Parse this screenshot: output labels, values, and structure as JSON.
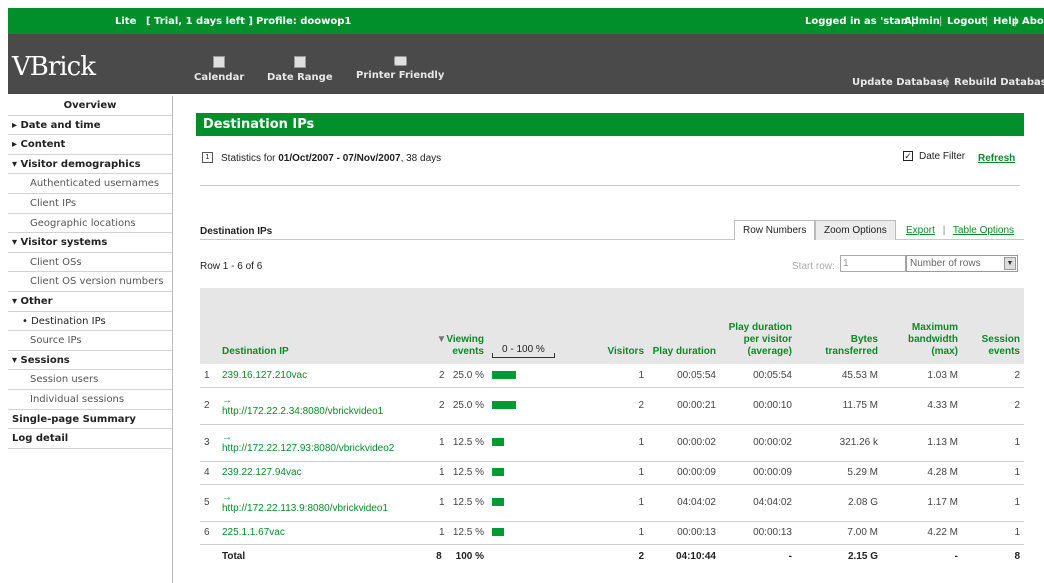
{
  "topbar": {
    "edition": "Lite",
    "trial": "[ Trial, 1 days left ]",
    "profile": "Profile: doowop1",
    "logged_in": "Logged in as 'stan'|",
    "admin": "Admin",
    "logout": "Logout",
    "help": "Help",
    "about": "Abou"
  },
  "header": {
    "logo": "VBrick",
    "tools": [
      "Calendar",
      "Date Range",
      "Printer Friendly"
    ],
    "update_db": "Update Database",
    "rebuild_db": "Rebuild Databas"
  },
  "sidebar": {
    "items": [
      {
        "label": "Overview",
        "type": "top-center"
      },
      {
        "label": "▸ Date and time",
        "type": "top"
      },
      {
        "label": "▸ Content",
        "type": "top"
      },
      {
        "label": "▾ Visitor demographics",
        "type": "top"
      },
      {
        "label": "Authenticated usernames",
        "type": "sub"
      },
      {
        "label": "Client IPs",
        "type": "sub"
      },
      {
        "label": "Geographic locations",
        "type": "sub"
      },
      {
        "label": "▾ Visitor systems",
        "type": "top"
      },
      {
        "label": "Client OSs",
        "type": "sub"
      },
      {
        "label": "Client OS version numbers",
        "type": "sub"
      },
      {
        "label": "▾ Other",
        "type": "top"
      },
      {
        "label": "• Destination IPs",
        "type": "current"
      },
      {
        "label": "Source IPs",
        "type": "sub"
      },
      {
        "label": "▾ Sessions",
        "type": "top"
      },
      {
        "label": "Session users",
        "type": "sub"
      },
      {
        "label": "Individual sessions",
        "type": "sub"
      },
      {
        "label": "Single-page Summary",
        "type": "top"
      },
      {
        "label": "Log detail",
        "type": "top"
      }
    ]
  },
  "page": {
    "title": "Destination IPs",
    "stats_prefix": "Statistics for",
    "stats_range": "01/Oct/2007 - 07/Nov/2007",
    "stats_suffix": ", 38 days",
    "date_filter": "Date Filter",
    "date_filter_checked": true,
    "refresh": "Refresh",
    "section_title": "Destination IPs",
    "tab_row_numbers": "Row Numbers",
    "tab_zoom": "Zoom Options",
    "export": "Export",
    "table_options": "Table Options",
    "row_info": "Row 1 - 6 of 6",
    "start_row_label": "Start row:",
    "start_row_value": "1",
    "number_of_rows": "Number of rows"
  },
  "table": {
    "headers": {
      "dest_ip": "Destination IP",
      "viewing_events": "Viewing events",
      "scale": "0 - 100 %",
      "visitors": "Visitors",
      "play_duration": "Play duration",
      "play_per_visitor": "Play duration per visitor (average)",
      "bytes": "Bytes transferred",
      "max_bw": "Maximum bandwidth (max)",
      "session_events": "Session events"
    },
    "rows": [
      {
        "n": "1",
        "ip": "239.16.127.210vac",
        "ip_is_url": false,
        "events": "2",
        "pct": "25.0 %",
        "pct_value": 25,
        "visitors": "1",
        "play": "00:05:54",
        "per_visitor": "00:05:54",
        "bytes": "45.53 M",
        "bw": "1.03 M",
        "sessions": "2"
      },
      {
        "n": "2",
        "ip": "http://172.22.2.34:8080/vbrickvideo1",
        "ip_is_url": true,
        "events": "2",
        "pct": "25.0 %",
        "pct_value": 25,
        "visitors": "2",
        "play": "00:00:21",
        "per_visitor": "00:00:10",
        "bytes": "11.75 M",
        "bw": "4.33 M",
        "sessions": "2"
      },
      {
        "n": "3",
        "ip": "http://172.22.127.93:8080/vbrickvideo2",
        "ip_is_url": true,
        "events": "1",
        "pct": "12.5 %",
        "pct_value": 12.5,
        "visitors": "1",
        "play": "00:00:02",
        "per_visitor": "00:00:02",
        "bytes": "321.26 k",
        "bw": "1.13 M",
        "sessions": "1"
      },
      {
        "n": "4",
        "ip": "239.22.127.94vac",
        "ip_is_url": false,
        "events": "1",
        "pct": "12.5 %",
        "pct_value": 12.5,
        "visitors": "1",
        "play": "00:00:09",
        "per_visitor": "00:00:09",
        "bytes": "5.29 M",
        "bw": "4.28 M",
        "sessions": "1"
      },
      {
        "n": "5",
        "ip": "http://172.22.113.9:8080/vbrickvideo1",
        "ip_is_url": true,
        "events": "1",
        "pct": "12.5 %",
        "pct_value": 12.5,
        "visitors": "1",
        "play": "04:04:02",
        "per_visitor": "04:04:02",
        "bytes": "2.08 G",
        "bw": "1.17 M",
        "sessions": "1"
      },
      {
        "n": "6",
        "ip": "225.1.1.67vac",
        "ip_is_url": false,
        "events": "1",
        "pct": "12.5 %",
        "pct_value": 12.5,
        "visitors": "1",
        "play": "00:00:13",
        "per_visitor": "00:00:13",
        "bytes": "7.00 M",
        "bw": "4.22 M",
        "sessions": "1"
      }
    ],
    "total": {
      "label": "Total",
      "events": "8",
      "pct": "100 %",
      "visitors": "2",
      "play": "04:10:44",
      "per_visitor": "-",
      "bytes": "2.15 G",
      "bw": "-",
      "sessions": "8"
    }
  },
  "colors": {
    "brand_green": "#008f2a",
    "link_green": "#0a8a2a",
    "header_gray": "#4a4a4a",
    "bar_green": "#009a33"
  }
}
